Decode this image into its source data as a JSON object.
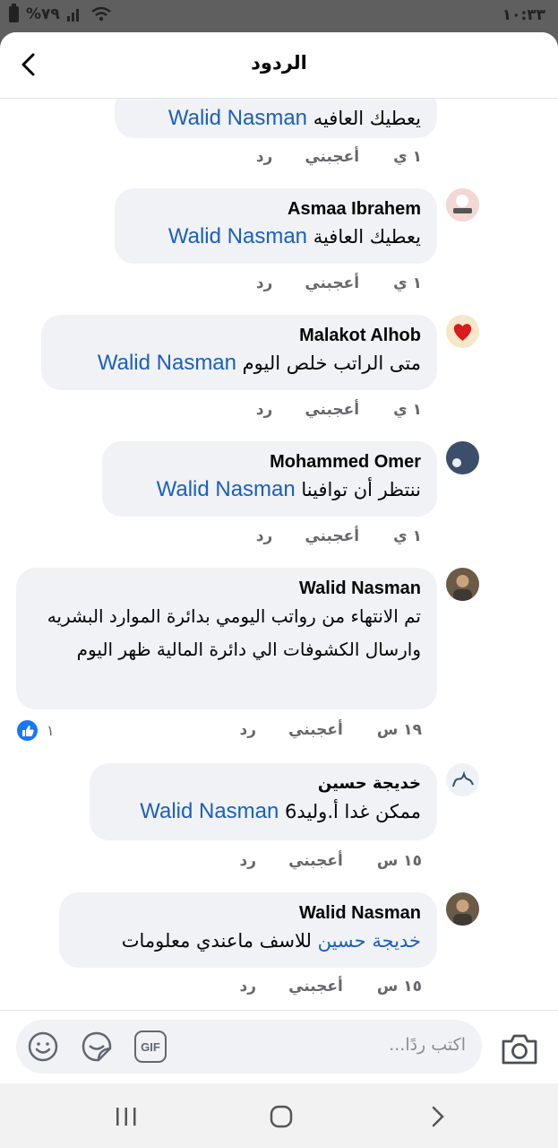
{
  "status_bar": {
    "time": "١٠:٣٣",
    "battery": "%٧٩"
  },
  "header": {
    "title": "الردود"
  },
  "comments": [
    {
      "author": "",
      "prefix": "يعطيك العافيه ",
      "mention": "Walid Nasman",
      "text": "",
      "time": "١ ي",
      "like": "أعجبني",
      "reply": "رد"
    },
    {
      "author": "Asmaa Ibrahem",
      "prefix": "يعطيك العافية ",
      "mention": "Walid Nasman",
      "text": "",
      "time": "١ ي",
      "like": "أعجبني",
      "reply": "رد"
    },
    {
      "author": "Malakot Alhob",
      "prefix": "متى الراتب خلص اليوم ",
      "mention": "Walid Nasman",
      "text": "",
      "time": "١ ي",
      "like": "أعجبني",
      "reply": "رد"
    },
    {
      "author": "Mohammed Omer",
      "prefix": "ننتظر أن توافينا ",
      "mention": "Walid Nasman",
      "text": "",
      "time": "١ ي",
      "like": "أعجبني",
      "reply": "رد"
    },
    {
      "author": "Walid Nasman",
      "prefix": "",
      "mention": "",
      "text": "تم الانتهاء من رواتب اليومي بدائرة الموارد البشريه وارسال الكشوفات الي دائرة المالية ظهر اليوم",
      "time": "١٩ س",
      "like": "أعجبني",
      "reply": "رد",
      "reaction_count": "١"
    },
    {
      "author": "خديجة حسين",
      "prefix": "ممكن غدا أ.وليد6 ",
      "mention": "Walid Nasman",
      "text": "",
      "time": "١٥ س",
      "like": "أعجبني",
      "reply": "رد"
    },
    {
      "author": "Walid Nasman",
      "prefix": "",
      "mention": "خديجة حسين",
      "text": " للاسف ماعندي معلومات",
      "time": "١٥ س",
      "like": "أعجبني",
      "reply": "رد"
    }
  ],
  "composer": {
    "placeholder": "اكتب ردًا...",
    "gif_label": "GIF"
  }
}
